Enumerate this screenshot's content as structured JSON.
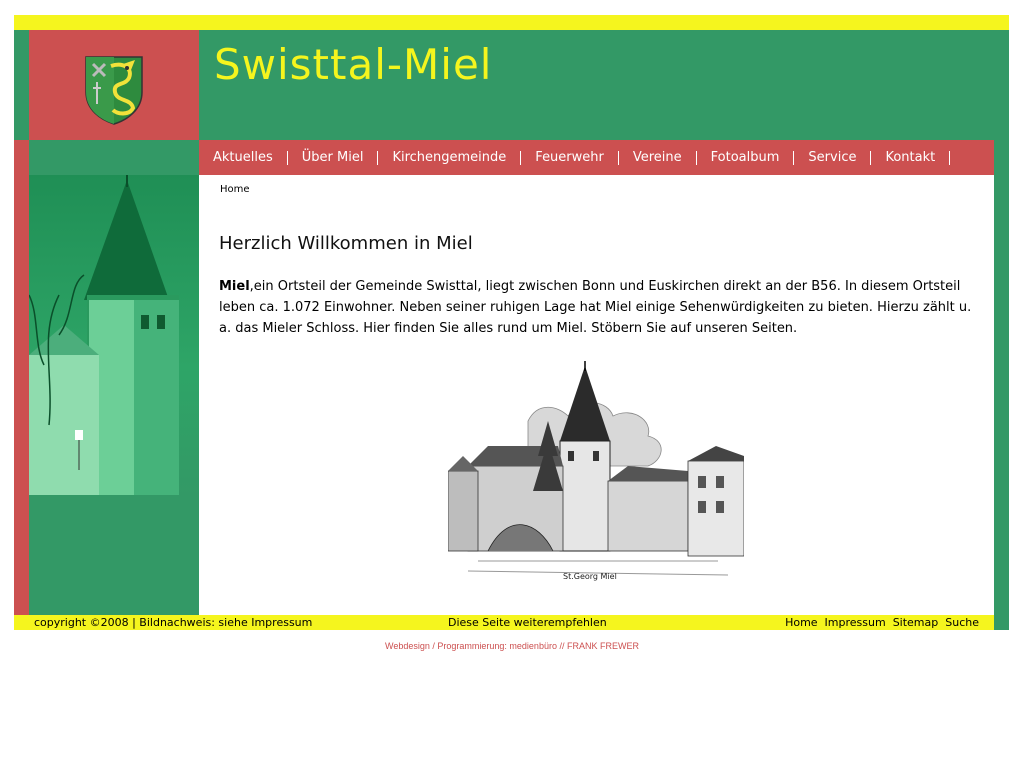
{
  "site": {
    "title": "Swisttal-Miel"
  },
  "nav": {
    "items": [
      {
        "label": "Aktuelles"
      },
      {
        "label": "Über Miel"
      },
      {
        "label": "Kirchengemeinde"
      },
      {
        "label": "Feuerwehr"
      },
      {
        "label": "Vereine"
      },
      {
        "label": "Fotoalbum"
      },
      {
        "label": "Service"
      },
      {
        "label": "Kontakt"
      }
    ]
  },
  "breadcrumb": "Home",
  "main": {
    "heading": "Herzlich Willkommen in Miel",
    "intro_bold": "Miel",
    "intro_text": ",ein Ortsteil der Gemeinde Swisttal, liegt zwischen Bonn und Euskirchen direkt an der B56. In diesem Ortsteil leben ca. 1.072 Einwohner. Neben seiner ruhigen Lage hat Miel einige Sehenwürdigkeiten zu bieten. Hierzu zählt u. a. das Mieler Schloss. Hier finden Sie alles rund um Miel. Stöbern Sie auf unseren Seiten.",
    "drawing_caption": "St.Georg Miel"
  },
  "footer": {
    "copyright": "copyright ©2008 | Bildnachweis: siehe Impressum",
    "recommend": "Diese Seite weiterempfehlen",
    "links": [
      "Home",
      "Impressum",
      "Sitemap",
      "Suche"
    ]
  },
  "credit": "Webdesign / Programmierung: medienbüro // FRANK FREWER",
  "colors": {
    "green": "#339966",
    "red": "#cc5050",
    "yellow": "#f5f51e"
  }
}
